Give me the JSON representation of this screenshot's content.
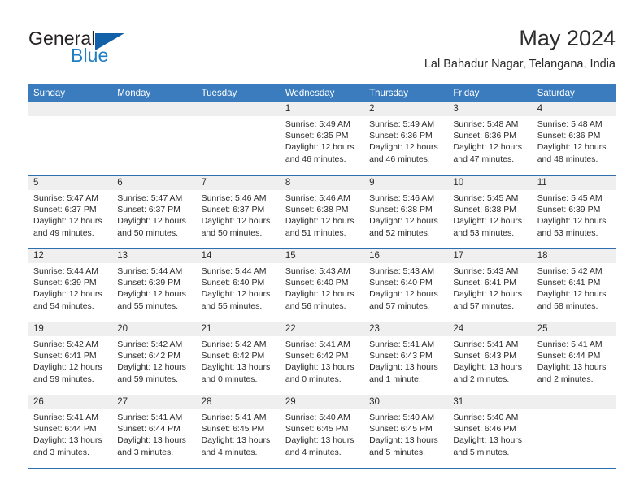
{
  "logo": {
    "word1": "General",
    "word2": "Blue",
    "mark": "triangle-mark"
  },
  "header": {
    "title": "May 2024",
    "subtitle": "Lal Bahadur Nagar, Telangana, India"
  },
  "colors": {
    "header_blue": "#3a7cbe",
    "rule_blue": "#2f6fae",
    "daynum_bg": "#efefef",
    "logo_blue": "#1f7ec4",
    "text": "#2b2b2b"
  },
  "weekdays": [
    "Sunday",
    "Monday",
    "Tuesday",
    "Wednesday",
    "Thursday",
    "Friday",
    "Saturday"
  ],
  "weeks": [
    [
      {
        "day": "",
        "empty": true,
        "sunrise": "",
        "sunset": "",
        "daylight_1": "",
        "daylight_2": ""
      },
      {
        "day": "",
        "empty": true,
        "sunrise": "",
        "sunset": "",
        "daylight_1": "",
        "daylight_2": ""
      },
      {
        "day": "",
        "empty": true,
        "sunrise": "",
        "sunset": "",
        "daylight_1": "",
        "daylight_2": ""
      },
      {
        "day": "1",
        "sunrise": "Sunrise: 5:49 AM",
        "sunset": "Sunset: 6:35 PM",
        "daylight_1": "Daylight: 12 hours",
        "daylight_2": "and 46 minutes."
      },
      {
        "day": "2",
        "sunrise": "Sunrise: 5:49 AM",
        "sunset": "Sunset: 6:36 PM",
        "daylight_1": "Daylight: 12 hours",
        "daylight_2": "and 46 minutes."
      },
      {
        "day": "3",
        "sunrise": "Sunrise: 5:48 AM",
        "sunset": "Sunset: 6:36 PM",
        "daylight_1": "Daylight: 12 hours",
        "daylight_2": "and 47 minutes."
      },
      {
        "day": "4",
        "sunrise": "Sunrise: 5:48 AM",
        "sunset": "Sunset: 6:36 PM",
        "daylight_1": "Daylight: 12 hours",
        "daylight_2": "and 48 minutes."
      }
    ],
    [
      {
        "day": "5",
        "sunrise": "Sunrise: 5:47 AM",
        "sunset": "Sunset: 6:37 PM",
        "daylight_1": "Daylight: 12 hours",
        "daylight_2": "and 49 minutes."
      },
      {
        "day": "6",
        "sunrise": "Sunrise: 5:47 AM",
        "sunset": "Sunset: 6:37 PM",
        "daylight_1": "Daylight: 12 hours",
        "daylight_2": "and 50 minutes."
      },
      {
        "day": "7",
        "sunrise": "Sunrise: 5:46 AM",
        "sunset": "Sunset: 6:37 PM",
        "daylight_1": "Daylight: 12 hours",
        "daylight_2": "and 50 minutes."
      },
      {
        "day": "8",
        "sunrise": "Sunrise: 5:46 AM",
        "sunset": "Sunset: 6:38 PM",
        "daylight_1": "Daylight: 12 hours",
        "daylight_2": "and 51 minutes."
      },
      {
        "day": "9",
        "sunrise": "Sunrise: 5:46 AM",
        "sunset": "Sunset: 6:38 PM",
        "daylight_1": "Daylight: 12 hours",
        "daylight_2": "and 52 minutes."
      },
      {
        "day": "10",
        "sunrise": "Sunrise: 5:45 AM",
        "sunset": "Sunset: 6:38 PM",
        "daylight_1": "Daylight: 12 hours",
        "daylight_2": "and 53 minutes."
      },
      {
        "day": "11",
        "sunrise": "Sunrise: 5:45 AM",
        "sunset": "Sunset: 6:39 PM",
        "daylight_1": "Daylight: 12 hours",
        "daylight_2": "and 53 minutes."
      }
    ],
    [
      {
        "day": "12",
        "sunrise": "Sunrise: 5:44 AM",
        "sunset": "Sunset: 6:39 PM",
        "daylight_1": "Daylight: 12 hours",
        "daylight_2": "and 54 minutes."
      },
      {
        "day": "13",
        "sunrise": "Sunrise: 5:44 AM",
        "sunset": "Sunset: 6:39 PM",
        "daylight_1": "Daylight: 12 hours",
        "daylight_2": "and 55 minutes."
      },
      {
        "day": "14",
        "sunrise": "Sunrise: 5:44 AM",
        "sunset": "Sunset: 6:40 PM",
        "daylight_1": "Daylight: 12 hours",
        "daylight_2": "and 55 minutes."
      },
      {
        "day": "15",
        "sunrise": "Sunrise: 5:43 AM",
        "sunset": "Sunset: 6:40 PM",
        "daylight_1": "Daylight: 12 hours",
        "daylight_2": "and 56 minutes."
      },
      {
        "day": "16",
        "sunrise": "Sunrise: 5:43 AM",
        "sunset": "Sunset: 6:40 PM",
        "daylight_1": "Daylight: 12 hours",
        "daylight_2": "and 57 minutes."
      },
      {
        "day": "17",
        "sunrise": "Sunrise: 5:43 AM",
        "sunset": "Sunset: 6:41 PM",
        "daylight_1": "Daylight: 12 hours",
        "daylight_2": "and 57 minutes."
      },
      {
        "day": "18",
        "sunrise": "Sunrise: 5:42 AM",
        "sunset": "Sunset: 6:41 PM",
        "daylight_1": "Daylight: 12 hours",
        "daylight_2": "and 58 minutes."
      }
    ],
    [
      {
        "day": "19",
        "sunrise": "Sunrise: 5:42 AM",
        "sunset": "Sunset: 6:41 PM",
        "daylight_1": "Daylight: 12 hours",
        "daylight_2": "and 59 minutes."
      },
      {
        "day": "20",
        "sunrise": "Sunrise: 5:42 AM",
        "sunset": "Sunset: 6:42 PM",
        "daylight_1": "Daylight: 12 hours",
        "daylight_2": "and 59 minutes."
      },
      {
        "day": "21",
        "sunrise": "Sunrise: 5:42 AM",
        "sunset": "Sunset: 6:42 PM",
        "daylight_1": "Daylight: 13 hours",
        "daylight_2": "and 0 minutes."
      },
      {
        "day": "22",
        "sunrise": "Sunrise: 5:41 AM",
        "sunset": "Sunset: 6:42 PM",
        "daylight_1": "Daylight: 13 hours",
        "daylight_2": "and 0 minutes."
      },
      {
        "day": "23",
        "sunrise": "Sunrise: 5:41 AM",
        "sunset": "Sunset: 6:43 PM",
        "daylight_1": "Daylight: 13 hours",
        "daylight_2": "and 1 minute."
      },
      {
        "day": "24",
        "sunrise": "Sunrise: 5:41 AM",
        "sunset": "Sunset: 6:43 PM",
        "daylight_1": "Daylight: 13 hours",
        "daylight_2": "and 2 minutes."
      },
      {
        "day": "25",
        "sunrise": "Sunrise: 5:41 AM",
        "sunset": "Sunset: 6:44 PM",
        "daylight_1": "Daylight: 13 hours",
        "daylight_2": "and 2 minutes."
      }
    ],
    [
      {
        "day": "26",
        "sunrise": "Sunrise: 5:41 AM",
        "sunset": "Sunset: 6:44 PM",
        "daylight_1": "Daylight: 13 hours",
        "daylight_2": "and 3 minutes."
      },
      {
        "day": "27",
        "sunrise": "Sunrise: 5:41 AM",
        "sunset": "Sunset: 6:44 PM",
        "daylight_1": "Daylight: 13 hours",
        "daylight_2": "and 3 minutes."
      },
      {
        "day": "28",
        "sunrise": "Sunrise: 5:41 AM",
        "sunset": "Sunset: 6:45 PM",
        "daylight_1": "Daylight: 13 hours",
        "daylight_2": "and 4 minutes."
      },
      {
        "day": "29",
        "sunrise": "Sunrise: 5:40 AM",
        "sunset": "Sunset: 6:45 PM",
        "daylight_1": "Daylight: 13 hours",
        "daylight_2": "and 4 minutes."
      },
      {
        "day": "30",
        "sunrise": "Sunrise: 5:40 AM",
        "sunset": "Sunset: 6:45 PM",
        "daylight_1": "Daylight: 13 hours",
        "daylight_2": "and 5 minutes."
      },
      {
        "day": "31",
        "sunrise": "Sunrise: 5:40 AM",
        "sunset": "Sunset: 6:46 PM",
        "daylight_1": "Daylight: 13 hours",
        "daylight_2": "and 5 minutes."
      },
      {
        "day": "",
        "empty": true,
        "sunrise": "",
        "sunset": "",
        "daylight_1": "",
        "daylight_2": ""
      }
    ]
  ]
}
